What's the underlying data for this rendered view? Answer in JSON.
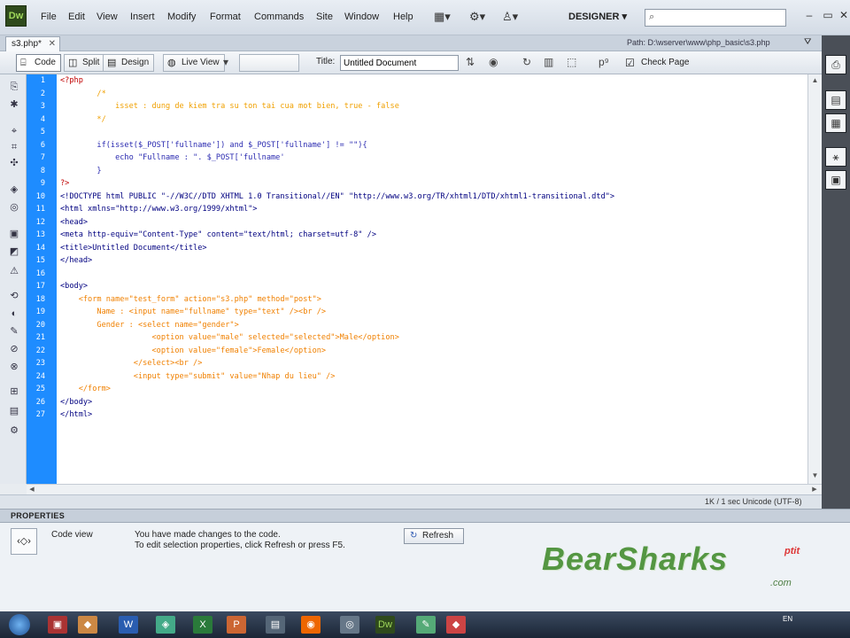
{
  "app": {
    "logo": "Dw",
    "menu": [
      "File",
      "Edit",
      "View",
      "Insert",
      "Modify",
      "Format",
      "Commands",
      "Site",
      "Window",
      "Help"
    ],
    "workspace": "DESIGNER",
    "search_placeholder": ""
  },
  "document": {
    "tab_label": "s3.php*",
    "path": "Path: D:\\wserver\\www\\php_basic\\s3.php",
    "toolbar": {
      "code": "Code",
      "split": "Split",
      "design": "Design",
      "live_view": "Live View",
      "title_label": "Title:",
      "title_value": "Untitled Document",
      "check_page": "Check Page"
    }
  },
  "code_lines": [
    "1",
    "2",
    "3",
    "4",
    "5",
    "6",
    "7",
    "8",
    "9",
    "10",
    "11",
    "12",
    "13",
    "14",
    "15",
    "16",
    "17",
    "18",
    "19",
    "20",
    "21",
    "22",
    "23",
    "24",
    "25",
    "26",
    "27"
  ],
  "code": {
    "l1": "<?php",
    "l2": "        /*",
    "l3": "            isset : dung de kiem tra su ton tai cua mot bien, true - false",
    "l4": "        */",
    "l6": "        if(isset($_POST['fullname']) and $_POST['fullname'] != \"\"){",
    "l7": "            echo \"Fullname : \". $_POST['fullname'",
    "l8": "        }",
    "l9": "?>",
    "l10": "<!DOCTYPE html PUBLIC \"-//W3C//DTD XHTML 1.0 Transitional//EN\" \"http://www.w3.org/TR/xhtml1/DTD/xhtml1-transitional.dtd\">",
    "l11": "<html xmlns=\"http://www.w3.org/1999/xhtml\">",
    "l12": "<head>",
    "l13": "<meta http-equiv=\"Content-Type\" content=\"text/html; charset=utf-8\" />",
    "l14": "<title>Untitled Document</title>",
    "l15": "</head>",
    "l17": "<body>",
    "l18": "    <form name=\"test_form\" action=\"s3.php\" method=\"post\">",
    "l19": "        Name : <input name=\"fullname\" type=\"text\" /><br />",
    "l20": "        Gender : <select name=\"gender\">",
    "l21": "                    <option value=\"male\" selected=\"selected\">Male</option>",
    "l22": "                    <option value=\"female\">Female</option>",
    "l23": "                </select><br />",
    "l24": "                <input type=\"submit\" value=\"Nhap du lieu\" />",
    "l25": "    </form>",
    "l26": "</body>",
    "l27": "</html>"
  },
  "status": {
    "right": "1K / 1 sec  Unicode (UTF-8)"
  },
  "properties": {
    "header": "PROPERTIES",
    "mode": "Code view",
    "msg1": "You have made changes to the code.",
    "msg2": "To edit selection properties, click Refresh or press F5.",
    "refresh": "Refresh"
  },
  "watermark": {
    "brand": "BearSharks",
    "tag": "ptit",
    "domain": ".com"
  },
  "taskbar": {
    "tray": "EN"
  }
}
